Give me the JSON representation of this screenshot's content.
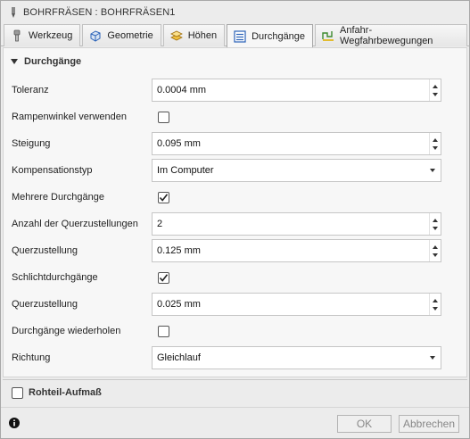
{
  "window": {
    "title": "BOHRFRÄSEN : BOHRFRÄSEN1"
  },
  "tabs": [
    {
      "label": "Werkzeug",
      "icon": "tool-icon",
      "active": false
    },
    {
      "label": "Geometrie",
      "icon": "geometry-icon",
      "active": false
    },
    {
      "label": "Höhen",
      "icon": "heights-icon",
      "active": false
    },
    {
      "label": "Durchgänge",
      "icon": "passes-icon",
      "active": true
    },
    {
      "label": "Anfahr-Wegfahrbewegungen",
      "icon": "linking-icon",
      "active": false
    }
  ],
  "section": {
    "title": "Durchgänge",
    "rows": {
      "toleranz": {
        "label": "Toleranz",
        "value": "0.0004 mm"
      },
      "rampenwinkel": {
        "label": "Rampenwinkel verwenden",
        "checked": false
      },
      "steigung": {
        "label": "Steigung",
        "value": "0.095 mm"
      },
      "kompensationstyp": {
        "label": "Kompensationstyp",
        "value": "Im Computer"
      },
      "mehrere": {
        "label": "Mehrere Durchgänge",
        "checked": true
      },
      "anzahl": {
        "label": "Anzahl der Querzustellungen",
        "value": "2"
      },
      "querzustellung1": {
        "label": "Querzustellung",
        "value": "0.125 mm"
      },
      "schlicht": {
        "label": "Schlichtdurchgänge",
        "checked": true
      },
      "querzustellung2": {
        "label": "Querzustellung",
        "value": "0.025 mm"
      },
      "wiederholen": {
        "label": "Durchgänge wiederholen",
        "checked": false
      },
      "richtung": {
        "label": "Richtung",
        "value": "Gleichlauf"
      }
    }
  },
  "rohteil": {
    "label": "Rohteil-Aufmaß",
    "checked": false
  },
  "footer": {
    "ok_label": "OK",
    "cancel_label": "Abbrechen"
  },
  "colors": {
    "accent": "#2a62b8",
    "panel": "#f7f7f7",
    "background": "#ececec"
  }
}
